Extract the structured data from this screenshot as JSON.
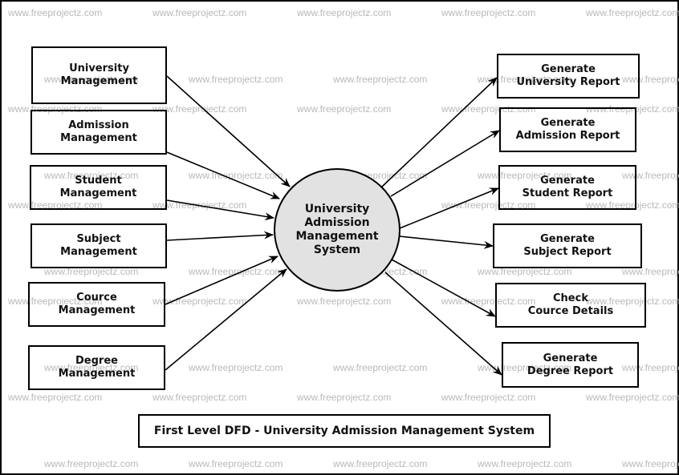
{
  "diagram": {
    "title": "First Level DFD - University Admission Management System",
    "watermark": "www.freeprojectz.com",
    "process": {
      "lines": [
        "University",
        "Admission",
        "Management",
        "System"
      ],
      "fill": "#e2e2e2"
    },
    "inputs": [
      {
        "id": "university-management",
        "lines": [
          "University",
          "Management"
        ]
      },
      {
        "id": "admission-management",
        "lines": [
          "Admission",
          "Management"
        ]
      },
      {
        "id": "student-management",
        "lines": [
          "Student",
          "Management"
        ]
      },
      {
        "id": "subject-management",
        "lines": [
          "Subject",
          "Management"
        ]
      },
      {
        "id": "cource-management",
        "lines": [
          "Cource",
          "Management"
        ]
      },
      {
        "id": "degree-management",
        "lines": [
          "Degree",
          "Management"
        ]
      }
    ],
    "outputs": [
      {
        "id": "generate-university-report",
        "lines": [
          "Generate",
          "University Report"
        ]
      },
      {
        "id": "generate-admission-report",
        "lines": [
          "Generate",
          "Admission Report"
        ]
      },
      {
        "id": "generate-student-report",
        "lines": [
          "Generate",
          "Student Report"
        ]
      },
      {
        "id": "generate-subject-report",
        "lines": [
          "Generate",
          "Subject Report"
        ]
      },
      {
        "id": "check-cource-details",
        "lines": [
          "Check",
          "Cource Details"
        ]
      },
      {
        "id": "generate-degree-report",
        "lines": [
          "Generate",
          "Degree Report"
        ]
      }
    ],
    "flows": [
      {
        "from": "university-management",
        "to": "process"
      },
      {
        "from": "admission-management",
        "to": "process"
      },
      {
        "from": "student-management",
        "to": "process"
      },
      {
        "from": "subject-management",
        "to": "process"
      },
      {
        "from": "cource-management",
        "to": "process"
      },
      {
        "from": "degree-management",
        "to": "process"
      },
      {
        "from": "process",
        "to": "generate-university-report"
      },
      {
        "from": "process",
        "to": "generate-admission-report"
      },
      {
        "from": "process",
        "to": "generate-student-report"
      },
      {
        "from": "process",
        "to": "generate-subject-report"
      },
      {
        "from": "process",
        "to": "check-cource-details"
      },
      {
        "from": "process",
        "to": "generate-degree-report"
      }
    ]
  }
}
